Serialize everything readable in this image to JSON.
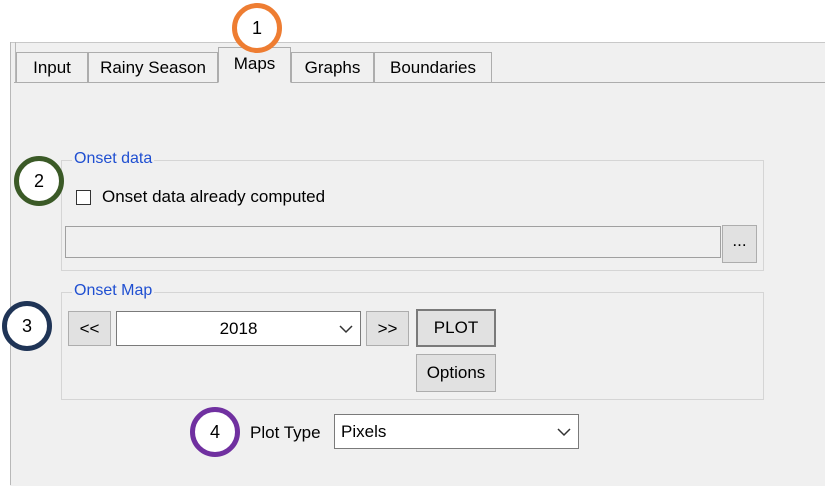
{
  "tabs": [
    "Input",
    "Rainy Season",
    "Maps",
    "Graphs",
    "Boundaries"
  ],
  "active_tab": "Maps",
  "onset_data": {
    "group_title": "Onset data",
    "checkbox_label": "Onset data already computed",
    "checked": false,
    "path_value": "",
    "browse_label": "..."
  },
  "onset_map": {
    "group_title": "Onset Map",
    "prev_label": "<<",
    "next_label": ">>",
    "year_value": "2018",
    "plot_label": "PLOT",
    "options_label": "Options"
  },
  "plot_type": {
    "label": "Plot Type",
    "value": "Pixels"
  },
  "markers": [
    {
      "number": "1",
      "color": "#ee7d32"
    },
    {
      "number": "2",
      "color": "#3b5a27"
    },
    {
      "number": "3",
      "color": "#1f3456"
    },
    {
      "number": "4",
      "color": "#7030a0"
    }
  ]
}
